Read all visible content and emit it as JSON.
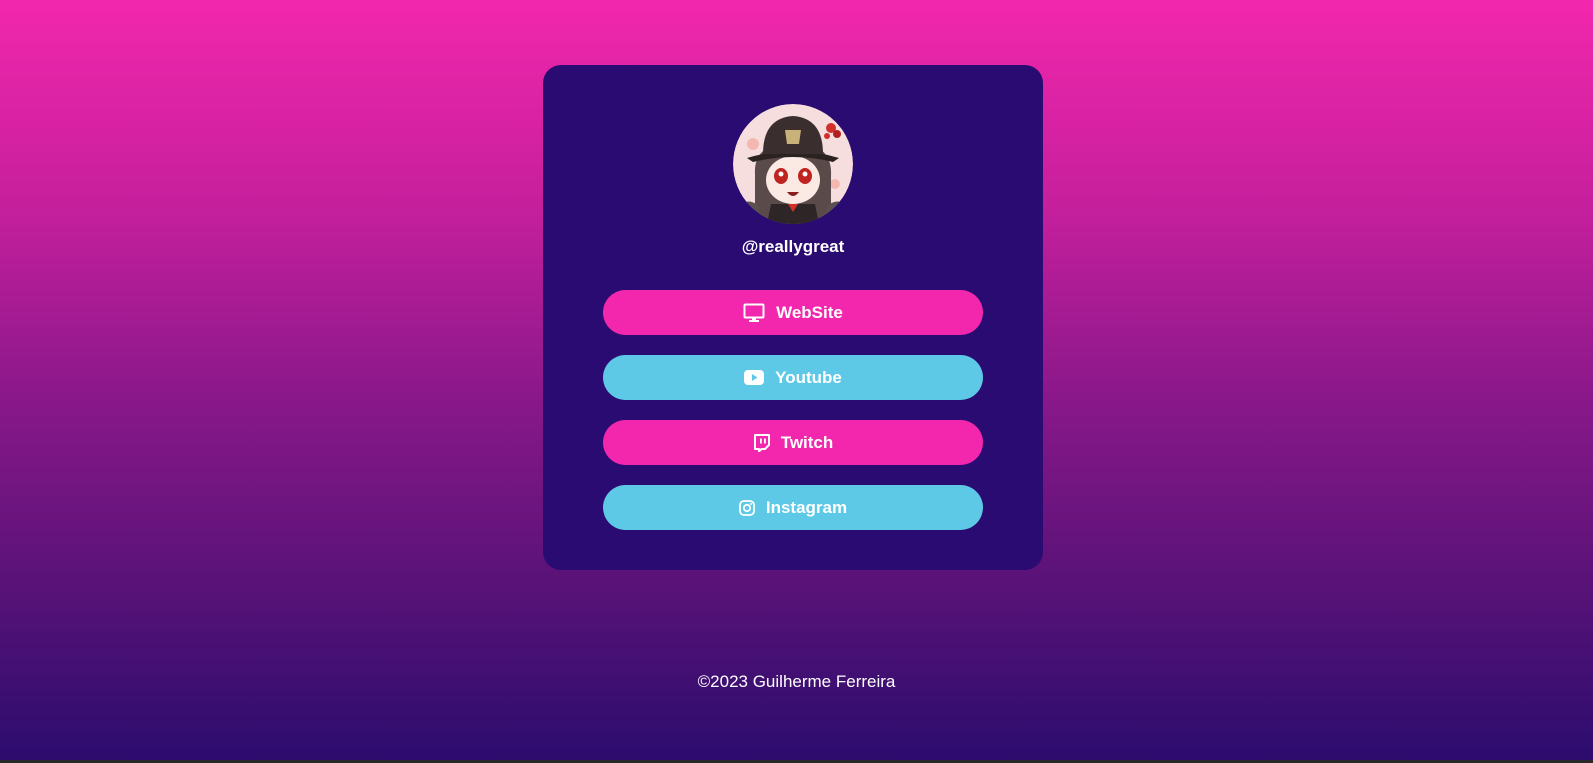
{
  "profile": {
    "handle": "@reallygreat"
  },
  "links": {
    "website": {
      "label": "WebSite",
      "icon": "monitor-icon",
      "color": "#f227ad"
    },
    "youtube": {
      "label": "Youtube",
      "icon": "youtube-icon",
      "color": "#5ec9e6"
    },
    "twitch": {
      "label": "Twitch",
      "icon": "twitch-icon",
      "color": "#f227ad"
    },
    "instagram": {
      "label": "Instagram",
      "icon": "instagram-icon",
      "color": "#5ec9e6"
    }
  },
  "footer": {
    "text": "©2023 Guilherme Ferreira"
  },
  "colors": {
    "card_background": "#2a0b72",
    "gradient_top": "#f227ad",
    "gradient_bottom": "#2b0c6e"
  }
}
